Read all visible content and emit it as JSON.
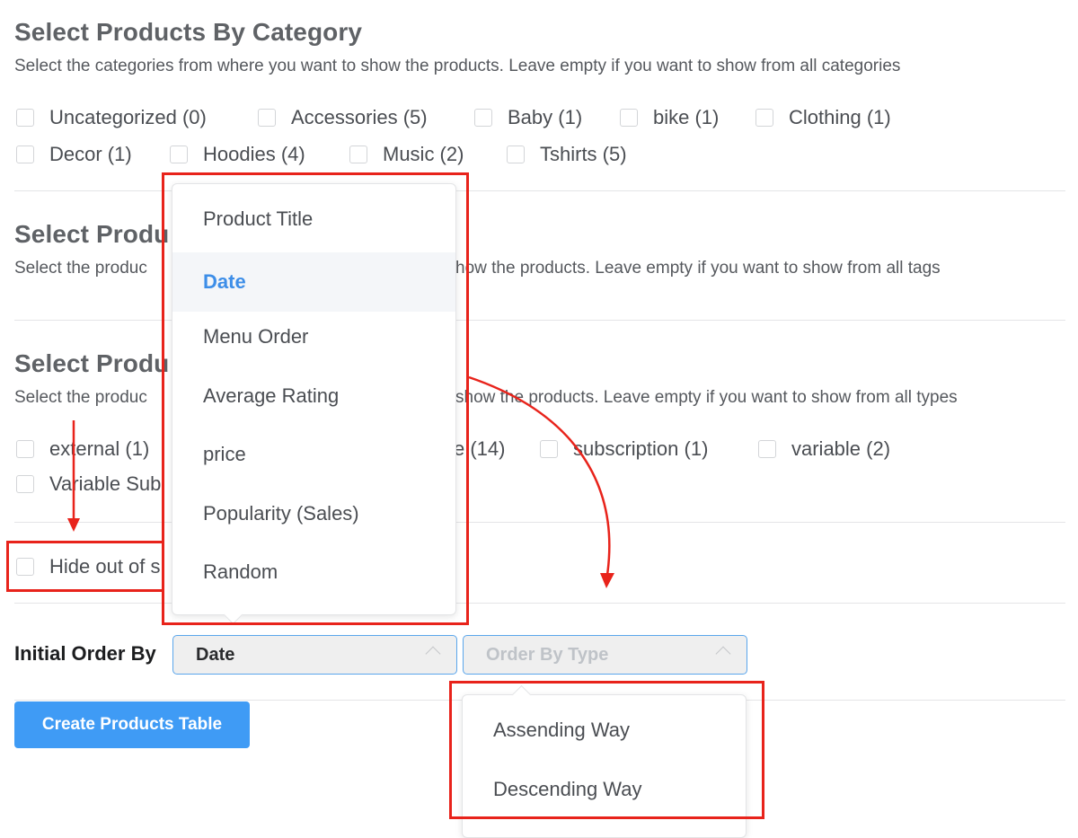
{
  "sections": {
    "category": {
      "title": "Select Products By Category",
      "description": "Select the categories from where you want to show the products. Leave empty if you want to show from all categories",
      "options": [
        {
          "label": "Uncategorized (0)",
          "checked": false
        },
        {
          "label": "Accessories (5)",
          "checked": false
        },
        {
          "label": "Baby (1)",
          "checked": false
        },
        {
          "label": "bike (1)",
          "checked": false
        },
        {
          "label": "Clothing (1)",
          "checked": false
        },
        {
          "label": "Decor (1)",
          "checked": false
        },
        {
          "label": "Hoodies (4)",
          "checked": false
        },
        {
          "label": "Music (2)",
          "checked": false
        },
        {
          "label": "Tshirts (5)",
          "checked": false
        }
      ]
    },
    "tag": {
      "title": "Select Produ",
      "description_left": "Select the produc",
      "description_right": "how the products. Leave empty if you want to show from all tags"
    },
    "type": {
      "title": "Select Produ",
      "description_left": "Select the produc",
      "description_right": "show the products. Leave empty if you want to show from all types",
      "options": [
        {
          "label": "external (1)",
          "checked": false
        },
        {
          "label": "e (14)",
          "checked": false
        },
        {
          "label": "subscription (1)",
          "checked": false
        },
        {
          "label": "variable (2)",
          "checked": false
        },
        {
          "label": "Variable Sub",
          "checked": false
        }
      ]
    },
    "stock": {
      "label": "Hide out of s",
      "checked": false
    }
  },
  "order_by_menu": {
    "items": [
      "Product Title",
      "Date",
      "Menu Order",
      "Average Rating",
      "price",
      "Popularity (Sales)",
      "Random"
    ],
    "selected": "Date"
  },
  "initial_order": {
    "label": "Initial Order By",
    "order_by_value": "Date",
    "order_type_placeholder": "Order By Type"
  },
  "order_type_menu": {
    "items": [
      "Assending Way",
      "Descending Way"
    ]
  },
  "create_button": "Create Products Table",
  "colors": {
    "accent": "#3f9bf5",
    "selected_text": "#3d8ee8",
    "annotation": "#e8231b"
  }
}
